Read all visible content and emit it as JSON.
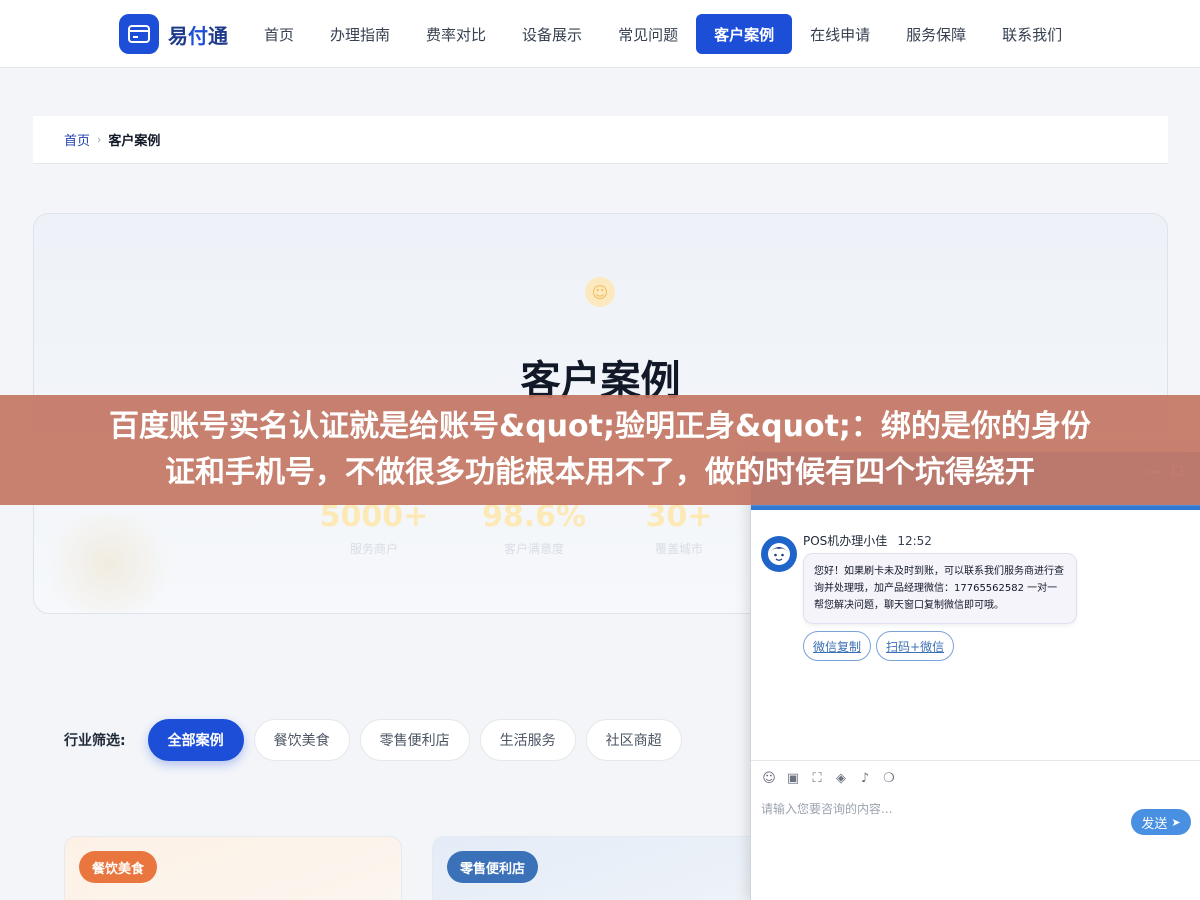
{
  "nav": {
    "logo_text_a": "易",
    "logo_text_b": "付",
    "logo_text_c": "通",
    "items": [
      {
        "label": "首页"
      },
      {
        "label": "办理指南"
      },
      {
        "label": "费率对比"
      },
      {
        "label": "设备展示"
      },
      {
        "label": "常见问题"
      },
      {
        "label": "客户案例"
      },
      {
        "label": "在线申请"
      },
      {
        "label": "服务保障"
      },
      {
        "label": "联系我们"
      }
    ],
    "active_index": 5
  },
  "breadcrumb": {
    "home": "首页",
    "separator": "›",
    "current": "客户案例"
  },
  "hero": {
    "title": "客户案例",
    "stats": [
      {
        "value": "5000+",
        "label": "服务商户"
      },
      {
        "value": "98.6%",
        "label": "客户满意度"
      },
      {
        "value": "30+",
        "label": "覆盖城市"
      }
    ]
  },
  "banner": {
    "line1": "百度账号实名认证就是给账号&quot;验明正身&quot;：绑的是你的身份",
    "line2": "证和手机号，不做很多功能根本用不了，做的时候有四个坑得绕开"
  },
  "filter": {
    "label": "行业筛选:",
    "chips": [
      {
        "label": "全部案例"
      },
      {
        "label": "餐饮美食"
      },
      {
        "label": "零售便利店"
      },
      {
        "label": "生活服务"
      },
      {
        "label": "社区商超"
      }
    ],
    "active_index": 0
  },
  "cards": [
    {
      "tag": "餐饮美食"
    },
    {
      "tag": "零售便利店"
    }
  ],
  "chat": {
    "minimize": "—",
    "maximize": "☐",
    "agent_name": "POS机办理小佳",
    "time": "12:52",
    "message": "您好！如果刷卡未及时到账，可以联系我们服务商进行查询并处理哦，加产品经理微信：17765562582 一对一帮您解决问题，聊天窗口复制微信即可哦。",
    "quick_buttons": [
      {
        "label": "微信复制"
      },
      {
        "label": "扫码+微信"
      }
    ],
    "input_placeholder": "请输入您要咨询的内容...",
    "send_label": "发送"
  },
  "colors": {
    "brand": "#1d4ed8",
    "banner": "#c47664",
    "chat_header": "#4a90e2"
  }
}
